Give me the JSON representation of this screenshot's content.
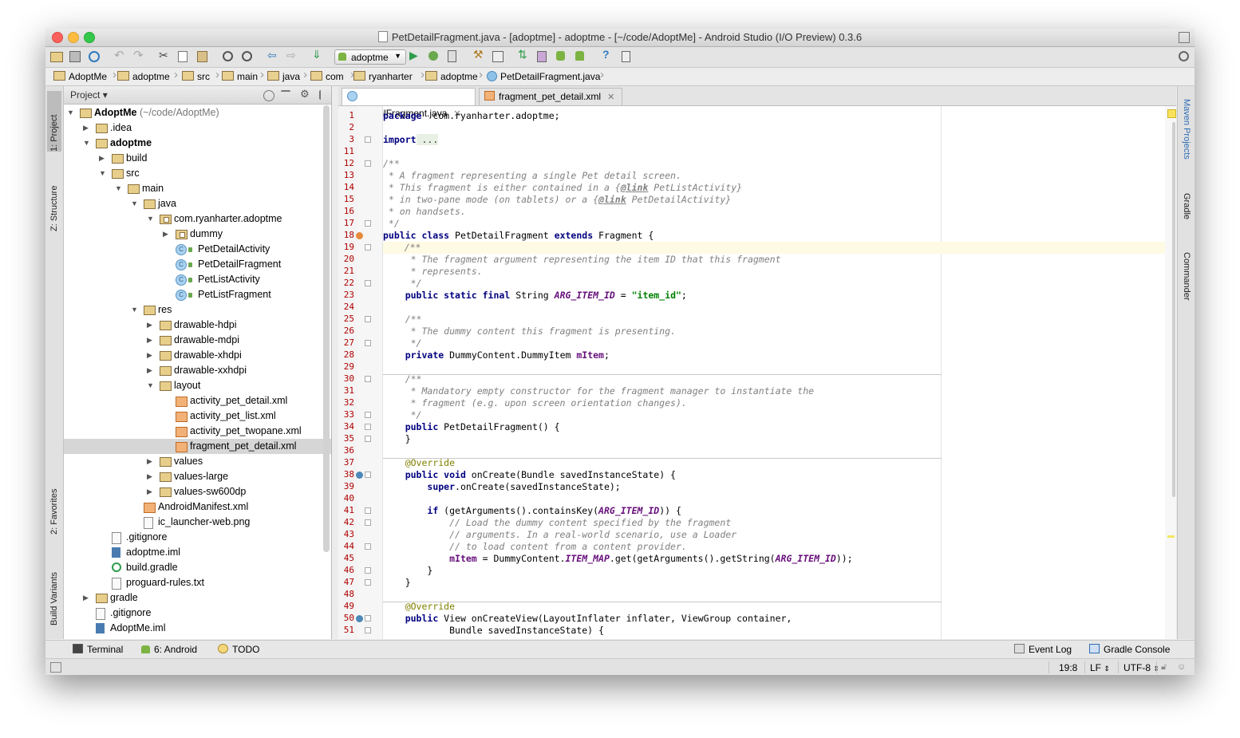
{
  "window": {
    "title": "PetDetailFragment.java - [adoptme] - adoptme - [~/code/AdoptMe] - Android Studio (I/O Preview) 0.3.6"
  },
  "toolbar": {
    "run_config": "adoptme"
  },
  "breadcrumbs": [
    "AdoptMe",
    "adoptme",
    "src",
    "main",
    "java",
    "com",
    "ryanharter",
    "adoptme",
    "PetDetailFragment.java"
  ],
  "left_tabs": [
    "1: Project",
    "Z: Structure",
    "2: Favorites",
    "Build Variants"
  ],
  "right_tabs": [
    "Maven Projects",
    "Gradle",
    "Commander"
  ],
  "project_panel": {
    "header": "Project",
    "tree": [
      {
        "label": "AdoptMe",
        "suffix": " (~/code/AdoptMe)",
        "depth": 0,
        "icon": "module",
        "expanded": true,
        "bold": true
      },
      {
        "label": ".idea",
        "depth": 1,
        "icon": "folder",
        "expanded": false
      },
      {
        "label": "adoptme",
        "depth": 1,
        "icon": "module",
        "expanded": true,
        "bold": true
      },
      {
        "label": "build",
        "depth": 2,
        "icon": "folder",
        "expanded": false
      },
      {
        "label": "src",
        "depth": 2,
        "icon": "folder",
        "expanded": true
      },
      {
        "label": "main",
        "depth": 3,
        "icon": "folder",
        "expanded": true
      },
      {
        "label": "java",
        "depth": 4,
        "icon": "folder",
        "expanded": true
      },
      {
        "label": "com.ryanharter.adoptme",
        "depth": 5,
        "icon": "package",
        "expanded": true
      },
      {
        "label": "dummy",
        "depth": 6,
        "icon": "package",
        "expanded": false
      },
      {
        "label": "PetDetailActivity",
        "depth": 6,
        "icon": "class"
      },
      {
        "label": "PetDetailFragment",
        "depth": 6,
        "icon": "class"
      },
      {
        "label": "PetListActivity",
        "depth": 6,
        "icon": "class"
      },
      {
        "label": "PetListFragment",
        "depth": 6,
        "icon": "class"
      },
      {
        "label": "res",
        "depth": 4,
        "icon": "folder",
        "expanded": true
      },
      {
        "label": "drawable-hdpi",
        "depth": 5,
        "icon": "folder",
        "expanded": false
      },
      {
        "label": "drawable-mdpi",
        "depth": 5,
        "icon": "folder",
        "expanded": false
      },
      {
        "label": "drawable-xhdpi",
        "depth": 5,
        "icon": "folder",
        "expanded": false
      },
      {
        "label": "drawable-xxhdpi",
        "depth": 5,
        "icon": "folder",
        "expanded": false
      },
      {
        "label": "layout",
        "depth": 5,
        "icon": "folder",
        "expanded": true
      },
      {
        "label": "activity_pet_detail.xml",
        "depth": 6,
        "icon": "xml"
      },
      {
        "label": "activity_pet_list.xml",
        "depth": 6,
        "icon": "xml"
      },
      {
        "label": "activity_pet_twopane.xml",
        "depth": 6,
        "icon": "xml"
      },
      {
        "label": "fragment_pet_detail.xml",
        "depth": 6,
        "icon": "xml",
        "selected": true
      },
      {
        "label": "values",
        "depth": 5,
        "icon": "folder",
        "expanded": false
      },
      {
        "label": "values-large",
        "depth": 5,
        "icon": "folder",
        "expanded": false
      },
      {
        "label": "values-sw600dp",
        "depth": 5,
        "icon": "folder",
        "expanded": false
      },
      {
        "label": "AndroidManifest.xml",
        "depth": 4,
        "icon": "xml"
      },
      {
        "label": "ic_launcher-web.png",
        "depth": 4,
        "icon": "file"
      },
      {
        "label": ".gitignore",
        "depth": 2,
        "icon": "file"
      },
      {
        "label": "adoptme.iml",
        "depth": 2,
        "icon": "iml"
      },
      {
        "label": "build.gradle",
        "depth": 2,
        "icon": "gradle"
      },
      {
        "label": "proguard-rules.txt",
        "depth": 2,
        "icon": "file"
      },
      {
        "label": "gradle",
        "depth": 1,
        "icon": "folder",
        "expanded": false
      },
      {
        "label": ".gitignore",
        "depth": 1,
        "icon": "file"
      },
      {
        "label": "AdoptMe.iml",
        "depth": 1,
        "icon": "iml"
      }
    ]
  },
  "editor": {
    "tabs": [
      {
        "label": "PetDetailFragment.java",
        "active": true,
        "icon": "class"
      },
      {
        "label": "fragment_pet_detail.xml",
        "active": false,
        "icon": "xml"
      }
    ],
    "current_line": 19,
    "lines": [
      {
        "n": "1",
        "segs": [
          [
            "kw",
            "package"
          ],
          [
            "",
            "  com.ryanharter.adoptme;"
          ]
        ]
      },
      {
        "n": "2",
        "segs": []
      },
      {
        "n": "3",
        "segs": [
          [
            "kw",
            "import"
          ],
          [
            "import-fold",
            " ..."
          ]
        ]
      },
      {
        "n": "11",
        "segs": []
      },
      {
        "n": "12",
        "segs": [
          [
            "jd",
            "/**"
          ]
        ]
      },
      {
        "n": "13",
        "segs": [
          [
            "jd",
            " * A fragment representing a single Pet detail screen."
          ]
        ]
      },
      {
        "n": "14",
        "segs": [
          [
            "jd",
            " * This fragment is either contained in a {"
          ],
          [
            "tag",
            "@link"
          ],
          [
            "jd",
            " PetListActivity}"
          ]
        ]
      },
      {
        "n": "15",
        "segs": [
          [
            "jd",
            " * in two-pane mode (on tablets) or a {"
          ],
          [
            "tag",
            "@link"
          ],
          [
            "jd",
            " PetDetailActivity}"
          ]
        ]
      },
      {
        "n": "16",
        "segs": [
          [
            "jd",
            " * on handsets."
          ]
        ]
      },
      {
        "n": "17",
        "segs": [
          [
            "jd",
            " */"
          ]
        ]
      },
      {
        "n": "18",
        "segs": [
          [
            "kw",
            "public class"
          ],
          [
            "",
            " PetDetailFragment "
          ],
          [
            "kw",
            "extends"
          ],
          [
            "",
            " Fragment {"
          ]
        ]
      },
      {
        "n": "19",
        "segs": [
          [
            "jd",
            "    /**"
          ]
        ]
      },
      {
        "n": "20",
        "segs": [
          [
            "jd",
            "     * The fragment argument representing the item ID that this fragment"
          ]
        ]
      },
      {
        "n": "21",
        "segs": [
          [
            "jd",
            "     * represents."
          ]
        ]
      },
      {
        "n": "22",
        "segs": [
          [
            "jd",
            "     */"
          ]
        ]
      },
      {
        "n": "23",
        "segs": [
          [
            "",
            "    "
          ],
          [
            "kw",
            "public static final"
          ],
          [
            "",
            " String "
          ],
          [
            "st",
            "ARG_ITEM_ID"
          ],
          [
            "",
            " = "
          ],
          [
            "str",
            "\"item_id\""
          ],
          [
            "",
            ";"
          ]
        ]
      },
      {
        "n": "24",
        "segs": []
      },
      {
        "n": "25",
        "segs": [
          [
            "jd",
            "    /**"
          ]
        ]
      },
      {
        "n": "26",
        "segs": [
          [
            "jd",
            "     * The dummy content this fragment is presenting."
          ]
        ]
      },
      {
        "n": "27",
        "segs": [
          [
            "jd",
            "     */"
          ]
        ]
      },
      {
        "n": "28",
        "segs": [
          [
            "",
            "    "
          ],
          [
            "kw",
            "private"
          ],
          [
            "",
            " DummyContent.DummyItem "
          ],
          [
            "fld",
            "mItem"
          ],
          [
            "",
            ";"
          ]
        ]
      },
      {
        "n": "29",
        "segs": []
      },
      {
        "n": "30",
        "segs": [
          [
            "jd",
            "    /**"
          ]
        ]
      },
      {
        "n": "31",
        "segs": [
          [
            "jd",
            "     * Mandatory empty constructor for the fragment manager to instantiate the"
          ]
        ]
      },
      {
        "n": "32",
        "segs": [
          [
            "jd",
            "     * fragment (e.g. upon screen orientation changes)."
          ]
        ]
      },
      {
        "n": "33",
        "segs": [
          [
            "jd",
            "     */"
          ]
        ]
      },
      {
        "n": "34",
        "segs": [
          [
            "",
            "    "
          ],
          [
            "kw",
            "public"
          ],
          [
            "",
            " PetDetailFragment() {"
          ]
        ]
      },
      {
        "n": "35",
        "segs": [
          [
            "",
            "    }"
          ]
        ]
      },
      {
        "n": "36",
        "segs": []
      },
      {
        "n": "37",
        "segs": [
          [
            "ann",
            "    @Override"
          ]
        ]
      },
      {
        "n": "38",
        "segs": [
          [
            "",
            "    "
          ],
          [
            "kw",
            "public void"
          ],
          [
            "",
            " onCreate(Bundle savedInstanceState) {"
          ]
        ]
      },
      {
        "n": "39",
        "segs": [
          [
            "",
            "        "
          ],
          [
            "kw",
            "super"
          ],
          [
            "",
            ".onCreate(savedInstanceState);"
          ]
        ]
      },
      {
        "n": "40",
        "segs": []
      },
      {
        "n": "41",
        "segs": [
          [
            "",
            "        "
          ],
          [
            "kw",
            "if"
          ],
          [
            "",
            " (getArguments().containsKey("
          ],
          [
            "st",
            "ARG_ITEM_ID"
          ],
          [
            "",
            ")) {"
          ]
        ]
      },
      {
        "n": "42",
        "segs": [
          [
            "cm",
            "            // Load the dummy content specified by the fragment"
          ]
        ]
      },
      {
        "n": "43",
        "segs": [
          [
            "cm",
            "            // arguments. In a real-world scenario, use a Loader"
          ]
        ]
      },
      {
        "n": "44",
        "segs": [
          [
            "cm",
            "            // to load content from a content provider."
          ]
        ]
      },
      {
        "n": "45",
        "segs": [
          [
            "",
            "            "
          ],
          [
            "fld",
            "mItem"
          ],
          [
            "",
            " = DummyContent."
          ],
          [
            "st",
            "ITEM_MAP"
          ],
          [
            "",
            ".get(getArguments().getString("
          ],
          [
            "st",
            "ARG_ITEM_ID"
          ],
          [
            "",
            "));"
          ]
        ]
      },
      {
        "n": "46",
        "segs": [
          [
            "",
            "        }"
          ]
        ]
      },
      {
        "n": "47",
        "segs": [
          [
            "",
            "    }"
          ]
        ]
      },
      {
        "n": "48",
        "segs": []
      },
      {
        "n": "49",
        "segs": [
          [
            "ann",
            "    @Override"
          ]
        ]
      },
      {
        "n": "50",
        "segs": [
          [
            "",
            "    "
          ],
          [
            "kw",
            "public"
          ],
          [
            "",
            " View onCreateView(LayoutInflater inflater, ViewGroup container,"
          ]
        ]
      },
      {
        "n": "51",
        "segs": [
          [
            "",
            "            Bundle savedInstanceState) {"
          ]
        ]
      }
    ]
  },
  "bottom_tools": {
    "terminal": "Terminal",
    "android": "6: Android",
    "todo": "TODO",
    "event_log": "Event Log",
    "gradle_console": "Gradle Console"
  },
  "status": {
    "position": "19:8",
    "line_sep": "LF",
    "encoding": "UTF-8"
  }
}
